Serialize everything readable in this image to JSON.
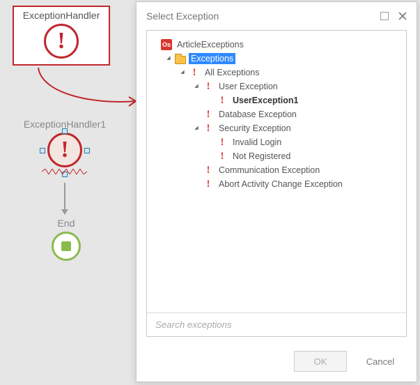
{
  "canvas": {
    "node1": {
      "title": "ExceptionHandler"
    },
    "node2": {
      "title": "ExceptionHandler1"
    },
    "end": {
      "title": "End"
    }
  },
  "dialog": {
    "title": "Select Exception",
    "search_placeholder": "Search exceptions",
    "buttons": {
      "ok": "OK",
      "cancel": "Cancel"
    },
    "tree": {
      "root": {
        "label": "ArticleExceptions"
      },
      "folder": {
        "label": "Exceptions"
      },
      "all": {
        "label": "All Exceptions"
      },
      "user": {
        "label": "User Exception"
      },
      "user1": {
        "label": "UserException1"
      },
      "db": {
        "label": "Database Exception"
      },
      "sec": {
        "label": "Security Exception"
      },
      "invalid": {
        "label": "Invalid Login"
      },
      "notreg": {
        "label": "Not Registered"
      },
      "comm": {
        "label": "Communication Exception"
      },
      "abort": {
        "label": "Abort Activity Change Exception"
      }
    }
  }
}
